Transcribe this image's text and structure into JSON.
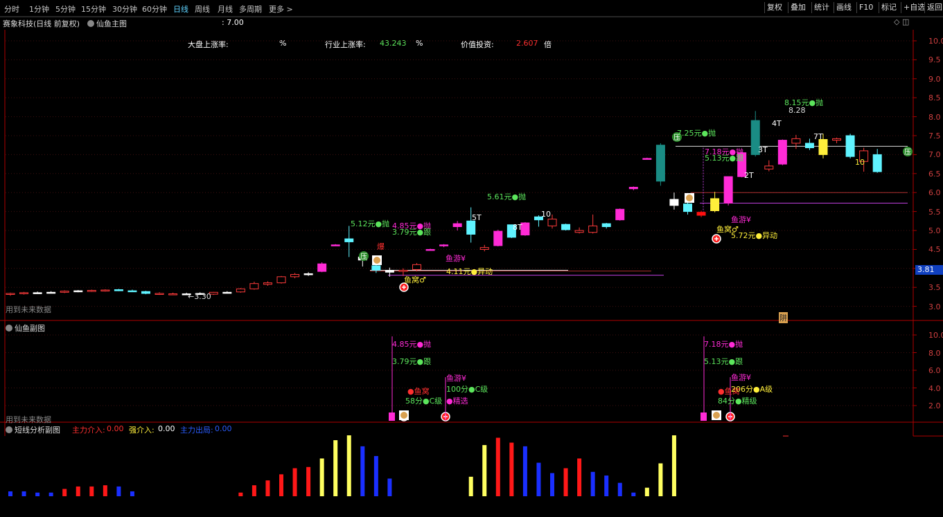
{
  "periods": [
    "分时",
    "1分钟",
    "5分钟",
    "15分钟",
    "30分钟",
    "60分钟",
    "日线",
    "周线",
    "月线",
    "多周期",
    "更多 >"
  ],
  "active_period": "日线",
  "toolbar_buttons": [
    "复权",
    "叠加",
    "统计",
    "画线",
    "F10",
    "标记",
    "+自选",
    "返回"
  ],
  "main_panel": {
    "stock": "赛象科技(日线 前复权)",
    "indicator": "仙鱼主图",
    "value": ": 7.00",
    "stats": {
      "market_label": "大盘上涨率:",
      "market_unit": "%",
      "industry_label": "行业上涨率:",
      "industry_value": "43.243",
      "industry_unit": "%",
      "value_label": "价值投资:",
      "value_value": "2.607",
      "value_unit": "倍"
    },
    "footer_note": "用到未来数据",
    "current_price": "3.81",
    "yaxis": [
      "10.0",
      "9.5",
      "9.0",
      "8.5",
      "8.0",
      "7.5",
      "7.0",
      "6.5",
      "6.0",
      "5.5",
      "5.0",
      "4.5",
      "4.0",
      "3.5",
      "3.0"
    ]
  },
  "sub1_panel": {
    "title": "仙鱼副图",
    "footer_note": "用到未来数据",
    "yaxis": [
      "10.0",
      "8.0",
      "6.0",
      "4.0",
      "2.0"
    ]
  },
  "sub2_panel": {
    "title": "短线分析副图",
    "main_label": "主力介入:",
    "main_value": "0.00",
    "strong_label": "强介入:",
    "strong_value": "0.00",
    "exit_label": "主力出局:",
    "exit_value": "0.00"
  },
  "annotations": {
    "low": "←3.30",
    "a1": "5.12元●抛",
    "a2": "4.85元●抛",
    "a3": "3.79元●跟",
    "a4": "5.61元●抛",
    "a5": "7.25元●抛",
    "a6": "7.18元●抛",
    "a7": "5.13元●跟",
    "a8": "8.15元●抛",
    "a9": "8.28",
    "a10": "4.11元●异动",
    "a11": "5.72元●异动",
    "yu_nest": "鱼窝♂",
    "yu_nest2": "鱼窝♂",
    "yu_swim": "鱼游¥",
    "yu_swim2": "鱼游¥",
    "ya": "压",
    "bao": "爆",
    "t5": "5T",
    "t8": "8T",
    "t10": "10",
    "t2": "2T",
    "t3": "3T",
    "t4": "4T",
    "t7": "7T",
    "t10b": "10",
    "jin": "阱",
    "s_a1": "4.85元●抛",
    "s_a2": "3.79元●跟",
    "s_a3": "●鱼窝",
    "s_a4": "58分●C级",
    "s_a5": "鱼游¥",
    "s_a6": "100分●C级",
    "s_a7": "●精选",
    "s_b1": "7.18元●抛",
    "s_b2": "5.13元●跟",
    "s_b3": "鱼游¥",
    "s_b4": "●鱼窝",
    "s_b5": "206分●A级",
    "s_b6": "84分●精级"
  },
  "colors": {
    "up": "#ff3b3b",
    "down": "#5ff3ff",
    "magenta": "#ff2bd6",
    "yellow": "#ffef3b",
    "green": "#5ce65c",
    "axis_red": "#b00000"
  },
  "chart_data": {
    "type": "candlestick",
    "candles": [
      {
        "o": 3.32,
        "h": 3.36,
        "l": 3.28,
        "c": 3.34,
        "col": "r"
      },
      {
        "o": 3.34,
        "h": 3.38,
        "l": 3.31,
        "c": 3.36,
        "col": "r"
      },
      {
        "o": 3.36,
        "h": 3.39,
        "l": 3.33,
        "c": 3.36,
        "col": "w"
      },
      {
        "o": 3.37,
        "h": 3.4,
        "l": 3.34,
        "c": 3.37,
        "col": "w"
      },
      {
        "o": 3.37,
        "h": 3.42,
        "l": 3.35,
        "c": 3.4,
        "col": "r"
      },
      {
        "o": 3.4,
        "h": 3.43,
        "l": 3.37,
        "c": 3.41,
        "col": "w"
      },
      {
        "o": 3.41,
        "h": 3.44,
        "l": 3.38,
        "c": 3.42,
        "col": "r"
      },
      {
        "o": 3.42,
        "h": 3.45,
        "l": 3.39,
        "c": 3.43,
        "col": "r"
      },
      {
        "o": 3.44,
        "h": 3.46,
        "l": 3.4,
        "c": 3.41,
        "col": "c"
      },
      {
        "o": 3.41,
        "h": 3.44,
        "l": 3.38,
        "c": 3.39,
        "col": "c"
      },
      {
        "o": 3.39,
        "h": 3.41,
        "l": 3.32,
        "c": 3.34,
        "col": "c"
      },
      {
        "o": 3.34,
        "h": 3.37,
        "l": 3.3,
        "c": 3.32,
        "col": "r"
      },
      {
        "o": 3.32,
        "h": 3.36,
        "l": 3.3,
        "c": 3.33,
        "col": "r"
      },
      {
        "o": 3.33,
        "h": 3.36,
        "l": 3.3,
        "c": 3.33,
        "col": "w"
      },
      {
        "o": 3.33,
        "h": 3.37,
        "l": 3.3,
        "c": 3.34,
        "col": "w"
      },
      {
        "o": 3.32,
        "h": 3.38,
        "l": 3.3,
        "c": 3.37,
        "col": "r"
      },
      {
        "o": 3.37,
        "h": 3.4,
        "l": 3.34,
        "c": 3.37,
        "col": "w"
      },
      {
        "o": 3.38,
        "h": 3.48,
        "l": 3.36,
        "c": 3.46,
        "col": "r"
      },
      {
        "o": 3.46,
        "h": 3.65,
        "l": 3.44,
        "c": 3.6,
        "col": "r"
      },
      {
        "o": 3.58,
        "h": 3.66,
        "l": 3.54,
        "c": 3.62,
        "col": "r"
      },
      {
        "o": 3.62,
        "h": 3.8,
        "l": 3.6,
        "c": 3.78,
        "col": "r"
      },
      {
        "o": 3.78,
        "h": 3.88,
        "l": 3.74,
        "c": 3.84,
        "col": "r"
      },
      {
        "o": 3.84,
        "h": 3.9,
        "l": 3.8,
        "c": 3.86,
        "col": "w"
      },
      {
        "o": 3.92,
        "h": 4.16,
        "l": 3.9,
        "c": 4.12,
        "col": "m"
      },
      {
        "o": 4.62,
        "h": 4.64,
        "l": 4.6,
        "c": 4.62,
        "col": "m"
      },
      {
        "o": 4.78,
        "h": 5.12,
        "l": 4.3,
        "c": 4.7,
        "col": "c"
      },
      {
        "o": 4.22,
        "h": 4.4,
        "l": 4.05,
        "c": 4.3,
        "col": "w"
      },
      {
        "o": 4.07,
        "h": 4.12,
        "l": 3.88,
        "c": 3.95,
        "col": "c"
      },
      {
        "o": 3.95,
        "h": 4.02,
        "l": 3.78,
        "c": 3.9,
        "col": "w"
      },
      {
        "o": 3.92,
        "h": 4.0,
        "l": 3.8,
        "c": 3.95,
        "col": "r"
      },
      {
        "o": 3.97,
        "h": 4.14,
        "l": 3.92,
        "c": 4.1,
        "col": "r"
      },
      {
        "o": 4.5,
        "h": 4.52,
        "l": 4.48,
        "c": 4.5,
        "col": "m"
      },
      {
        "o": 4.6,
        "h": 4.64,
        "l": 4.56,
        "c": 4.62,
        "col": "m"
      },
      {
        "o": 5.1,
        "h": 5.25,
        "l": 5.0,
        "c": 5.18,
        "col": "m"
      },
      {
        "o": 5.25,
        "h": 5.61,
        "l": 4.68,
        "c": 4.9,
        "col": "c"
      },
      {
        "o": 4.5,
        "h": 4.62,
        "l": 4.45,
        "c": 4.55,
        "col": "r"
      },
      {
        "o": 4.6,
        "h": 5.02,
        "l": 4.58,
        "c": 4.98,
        "col": "m"
      },
      {
        "o": 4.82,
        "h": 5.12,
        "l": 4.8,
        "c": 5.15,
        "col": "c"
      },
      {
        "o": 4.88,
        "h": 5.22,
        "l": 4.86,
        "c": 5.2,
        "col": "m"
      },
      {
        "o": 5.28,
        "h": 5.4,
        "l": 5.1,
        "c": 5.36,
        "col": "c"
      },
      {
        "o": 5.3,
        "h": 5.42,
        "l": 5.05,
        "c": 5.12,
        "col": "r"
      },
      {
        "o": 5.16,
        "h": 5.18,
        "l": 5.0,
        "c": 5.02,
        "col": "c"
      },
      {
        "o": 5.0,
        "h": 5.08,
        "l": 4.92,
        "c": 4.95,
        "col": "r"
      },
      {
        "o": 4.95,
        "h": 5.42,
        "l": 4.92,
        "c": 5.12,
        "col": "r"
      },
      {
        "o": 5.1,
        "h": 5.2,
        "l": 5.05,
        "c": 5.18,
        "col": "c"
      },
      {
        "o": 5.28,
        "h": 5.58,
        "l": 5.26,
        "c": 5.56,
        "col": "m"
      },
      {
        "o": 6.1,
        "h": 6.16,
        "l": 6.06,
        "c": 6.14,
        "col": "m"
      },
      {
        "o": 6.9,
        "h": 6.92,
        "l": 6.88,
        "c": 6.9,
        "col": "m"
      },
      {
        "o": 7.25,
        "h": 7.3,
        "l": 6.18,
        "c": 6.3,
        "col": "t"
      },
      {
        "o": 5.82,
        "h": 6.0,
        "l": 5.55,
        "c": 5.66,
        "col": "w"
      },
      {
        "o": 5.7,
        "h": 5.75,
        "l": 5.42,
        "c": 5.5,
        "col": "c"
      },
      {
        "o": 5.48,
        "h": 5.52,
        "l": 5.35,
        "c": 5.4,
        "col": "rr"
      },
      {
        "o": 5.52,
        "h": 6.02,
        "l": 5.48,
        "c": 5.84,
        "col": "y"
      },
      {
        "o": 5.72,
        "h": 6.42,
        "l": 5.66,
        "c": 6.42,
        "col": "m"
      },
      {
        "o": 6.42,
        "h": 7.08,
        "l": 6.4,
        "c": 7.05,
        "col": "m"
      },
      {
        "o": 7.9,
        "h": 8.15,
        "l": 6.95,
        "c": 7.0,
        "col": "t"
      },
      {
        "o": 6.62,
        "h": 6.85,
        "l": 6.56,
        "c": 6.7,
        "col": "r"
      },
      {
        "o": 6.75,
        "h": 7.4,
        "l": 6.72,
        "c": 7.38,
        "col": "m"
      },
      {
        "o": 7.3,
        "h": 7.52,
        "l": 7.15,
        "c": 7.42,
        "col": "r"
      },
      {
        "o": 7.3,
        "h": 7.42,
        "l": 7.12,
        "c": 7.18,
        "col": "c"
      },
      {
        "o": 7.4,
        "h": 7.55,
        "l": 6.9,
        "c": 7.0,
        "col": "y"
      },
      {
        "o": 7.38,
        "h": 7.45,
        "l": 7.3,
        "c": 7.42,
        "col": "r"
      },
      {
        "o": 7.5,
        "h": 7.55,
        "l": 6.9,
        "c": 6.95,
        "col": "c"
      },
      {
        "o": 6.82,
        "h": 7.18,
        "l": 6.55,
        "c": 7.1,
        "col": "r"
      },
      {
        "o": 7.0,
        "h": 7.15,
        "l": 6.52,
        "c": 6.55,
        "col": "c"
      }
    ],
    "volume_bars": [
      {
        "i": 0,
        "v": 0.08,
        "c": "b"
      },
      {
        "i": 1,
        "v": 0.08,
        "c": "b"
      },
      {
        "i": 2,
        "v": 0.06,
        "c": "b"
      },
      {
        "i": 3,
        "v": 0.06,
        "c": "b"
      },
      {
        "i": 4,
        "v": 0.12,
        "c": "r"
      },
      {
        "i": 5,
        "v": 0.16,
        "c": "r"
      },
      {
        "i": 6,
        "v": 0.16,
        "c": "r"
      },
      {
        "i": 7,
        "v": 0.18,
        "c": "r"
      },
      {
        "i": 8,
        "v": 0.16,
        "c": "b"
      },
      {
        "i": 9,
        "v": 0.08,
        "c": "b"
      },
      {
        "i": 17,
        "v": 0.06,
        "c": "r"
      },
      {
        "i": 18,
        "v": 0.18,
        "c": "r"
      },
      {
        "i": 19,
        "v": 0.26,
        "c": "r"
      },
      {
        "i": 20,
        "v": 0.36,
        "c": "r"
      },
      {
        "i": 21,
        "v": 0.46,
        "c": "r"
      },
      {
        "i": 22,
        "v": 0.48,
        "c": "r"
      },
      {
        "i": 23,
        "v": 0.62,
        "c": "y"
      },
      {
        "i": 24,
        "v": 0.92,
        "c": "y"
      },
      {
        "i": 25,
        "v": 1.0,
        "c": "y"
      },
      {
        "i": 26,
        "v": 0.82,
        "c": "b"
      },
      {
        "i": 27,
        "v": 0.66,
        "c": "b"
      },
      {
        "i": 28,
        "v": 0.29,
        "c": "b"
      },
      {
        "i": 34,
        "v": 0.32,
        "c": "y"
      },
      {
        "i": 35,
        "v": 0.84,
        "c": "y"
      },
      {
        "i": 36,
        "v": 0.96,
        "c": "r"
      },
      {
        "i": 37,
        "v": 0.88,
        "c": "r"
      },
      {
        "i": 38,
        "v": 0.82,
        "c": "b"
      },
      {
        "i": 39,
        "v": 0.55,
        "c": "b"
      },
      {
        "i": 40,
        "v": 0.38,
        "c": "b"
      },
      {
        "i": 41,
        "v": 0.46,
        "c": "r"
      },
      {
        "i": 42,
        "v": 0.62,
        "c": "r"
      },
      {
        "i": 43,
        "v": 0.4,
        "c": "b"
      },
      {
        "i": 44,
        "v": 0.34,
        "c": "b"
      },
      {
        "i": 45,
        "v": 0.22,
        "c": "b"
      },
      {
        "i": 46,
        "v": 0.06,
        "c": "b"
      },
      {
        "i": 47,
        "v": 0.14,
        "c": "y"
      },
      {
        "i": 48,
        "v": 0.54,
        "c": "y"
      },
      {
        "i": 49,
        "v": 1.0,
        "c": "y"
      }
    ]
  }
}
